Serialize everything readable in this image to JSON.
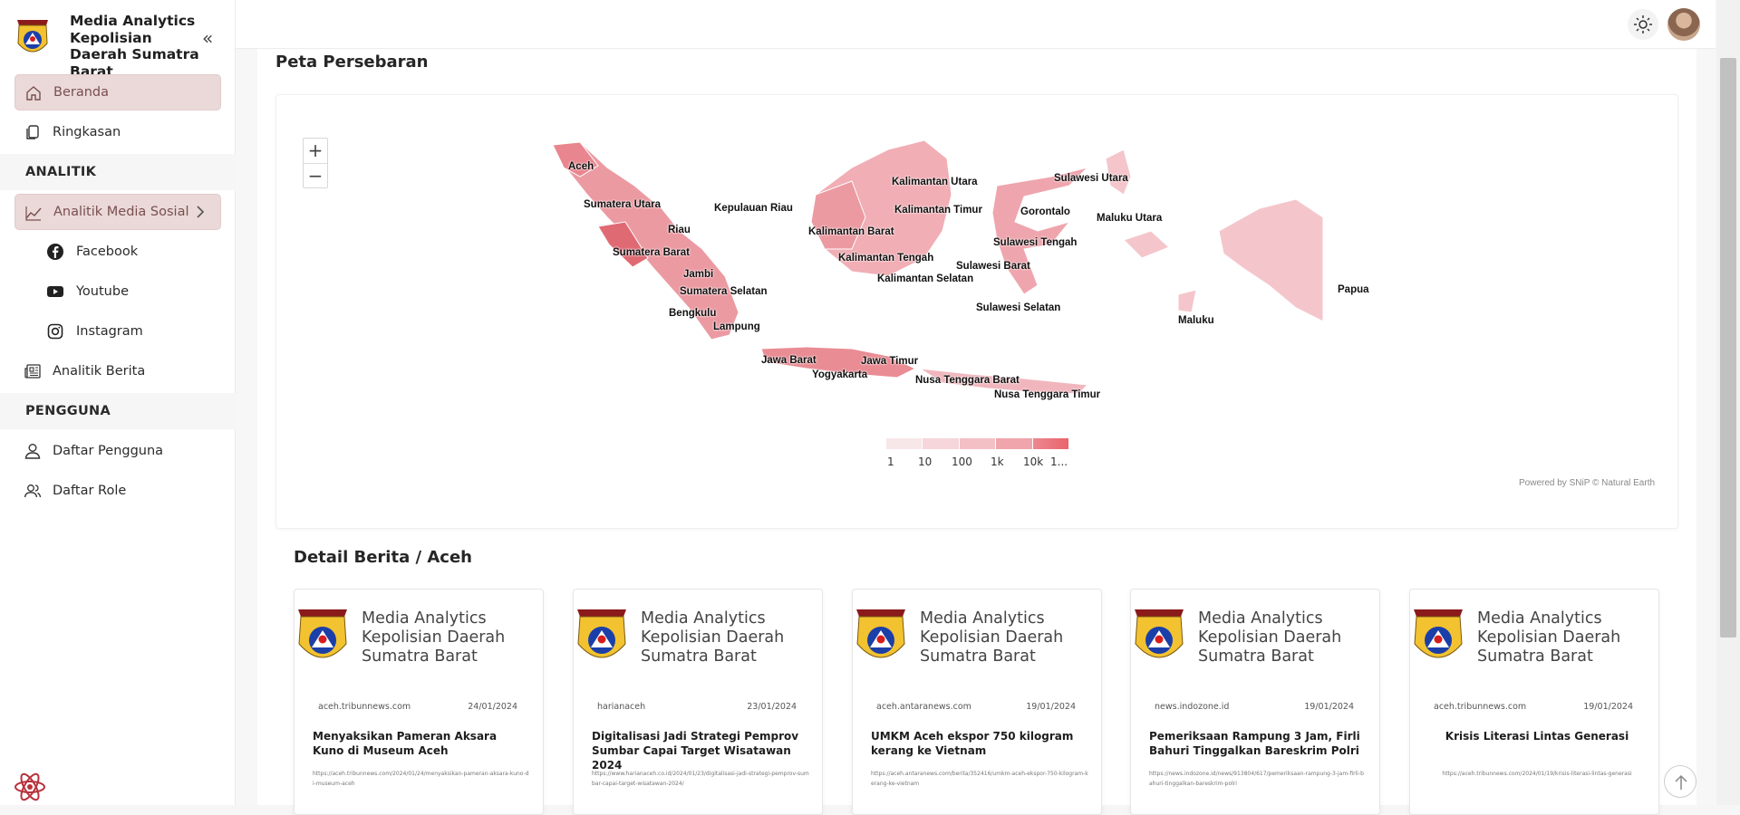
{
  "brand": {
    "title": "Media Analytics Kepolisian Daerah Sumatra Barat"
  },
  "nav": {
    "beranda": "Beranda",
    "ringkasan": "Ringkasan",
    "section_analitik": "ANALITIK",
    "analitik_media_sosial": "Analitik Media Sosial",
    "facebook": "Facebook",
    "youtube": "Youtube",
    "instagram": "Instagram",
    "analitik_berita": "Analitik Berita",
    "section_pengguna": "PENGGUNA",
    "daftar_pengguna": "Daftar Pengguna",
    "daftar_role": "Daftar Role"
  },
  "map": {
    "title": "Peta Persebaran",
    "zoom_in": "+",
    "zoom_out": "−",
    "labels": {
      "aceh": "Aceh",
      "sumut": "Sumatera Utara",
      "riau": "Riau",
      "kepri": "Kepulauan Riau",
      "sumbar": "Sumatera Barat",
      "jambi": "Jambi",
      "sumsel": "Sumatera Selatan",
      "bengkulu": "Bengkulu",
      "lampung": "Lampung",
      "kalut": "Kalimantan Utara",
      "kaltim": "Kalimantan Timur",
      "kalbar": "Kalimantan Barat",
      "kalteng": "Kalimantan Tengah",
      "kalsel": "Kalimantan Selatan",
      "sulut": "Sulawesi Utara",
      "gorontalo": "Gorontalo",
      "malut": "Maluku Utara",
      "sulteng": "Sulawesi Tengah",
      "sulbar": "Sulawesi Barat",
      "sulsel": "Sulawesi Selatan",
      "maluku": "Maluku",
      "papua": "Papua",
      "jabar": "Jawa Barat",
      "jatim": "Jawa Timur",
      "yogya": "Yogyakarta",
      "ntb": "Nusa Tenggara Barat",
      "ntt": "Nusa Tenggara Timur"
    },
    "legend": [
      "1",
      "10",
      "100",
      "1k",
      "10k",
      "1..."
    ],
    "legend_colors": [
      "#f7e7e9",
      "#f6d6da",
      "#f3c0c6",
      "#f0a5ad",
      "#ec8890",
      "#e9646c"
    ],
    "attribution": "Powered by SNiP © Natural Earth"
  },
  "news": {
    "title": "Detail Berita / Aceh",
    "brand": "Media Analytics Kepolisian Daerah Sumatra Barat",
    "items": [
      {
        "source": "aceh.tribunnews.com",
        "date": "24/01/2024",
        "headline": "Menyaksikan Pameran Aksara Kuno di Museum Aceh",
        "url": "https://aceh.tribunnews.com/2024/01/24/menyaksikan-pameran-aksara-kuno-di-museum-aceh"
      },
      {
        "source": "harianaceh",
        "date": "23/01/2024",
        "headline": "Digitalisasi Jadi Strategi Pemprov Sumbar Capai Target Wisatawan 2024",
        "url": "https://www.harianaceh.co.id/2024/01/23/digitalisasi-jadi-strategi-pemprov-sumbar-capai-target-wisatawan-2024/"
      },
      {
        "source": "aceh.antaranews.com",
        "date": "19/01/2024",
        "headline": "UMKM Aceh ekspor 750 kilogram kerang ke Vietnam",
        "url": "https://aceh.antaranews.com/berita/352416/umkm-aceh-ekspor-750-kilogram-kerang-ke-vietnam"
      },
      {
        "source": "news.indozone.id",
        "date": "19/01/2024",
        "headline": "Pemeriksaan Rampung 3 Jam, Firli Bahuri Tinggalkan Bareskrim Polri",
        "url": "https://news.indozone.id/news/913804/617/pemeriksaan-rampung-3-jam-firli-bahuri-tinggalkan-bareskrim-polri"
      },
      {
        "source": "aceh.tribunnews.com",
        "date": "19/01/2024",
        "headline": "Krisis Literasi Lintas Generasi",
        "url": "https://aceh.tribunnews.com/2024/01/19/krisis-literasi-lintas-generasi"
      }
    ]
  },
  "colors": {
    "accent": "#ead9d8",
    "map_light": "#f3c4ca",
    "map_dark": "#e47179"
  }
}
